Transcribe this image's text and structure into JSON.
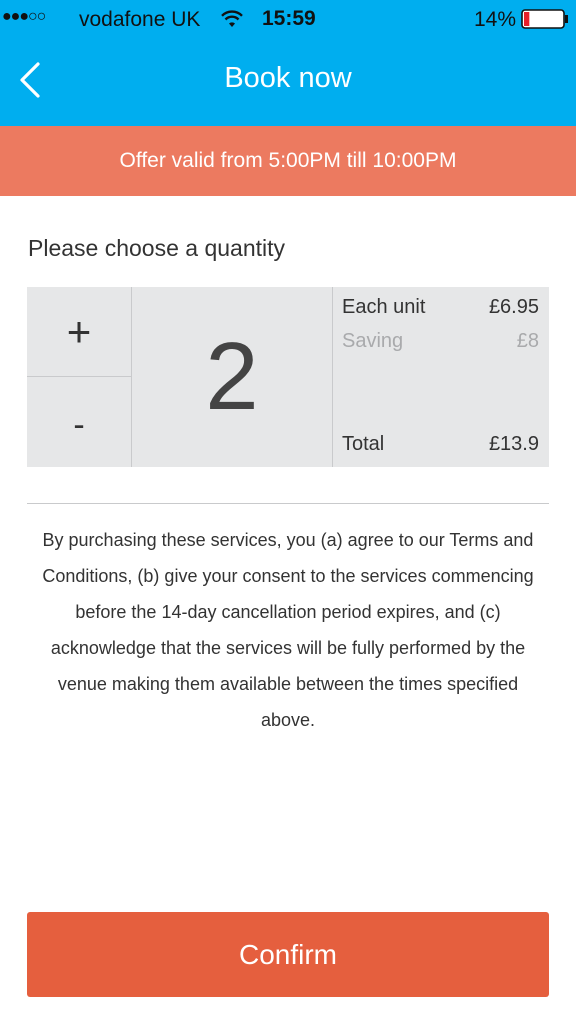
{
  "status_bar": {
    "signal": "●●●○○",
    "carrier": "vodafone UK",
    "time": "15:59",
    "battery_percent": "14%",
    "wifi_icon": "wifi-icon",
    "battery_icon": "battery-low-icon",
    "battery_level": 0.14
  },
  "header": {
    "title": "Book now",
    "back_icon": "chevron-left-icon"
  },
  "offer_banner": {
    "text": "Offer valid from 5:00PM till 10:00PM"
  },
  "quantity": {
    "heading": "Please choose a quantity",
    "plus_label": "+",
    "minus_label": "-",
    "value": "2"
  },
  "pricing": {
    "each_unit_label": "Each unit",
    "each_unit_value": "£6.95",
    "saving_label": "Saving",
    "saving_value": "£8",
    "total_label": "Total",
    "total_value": "£13.9"
  },
  "terms": {
    "text": "By purchasing these services, you (a) agree to our Terms and Conditions, (b) give your consent to the services commencing before the 14-day cancellation period expires, and (c) acknowledge that the services will be fully performed by the venue making them available between the times specified above."
  },
  "confirm": {
    "label": "Confirm"
  },
  "colors": {
    "header_bg": "#00aeef",
    "banner_bg": "#ec7a60",
    "confirm_bg": "#e55f3e",
    "qty_box_bg": "#e6e7e8"
  }
}
